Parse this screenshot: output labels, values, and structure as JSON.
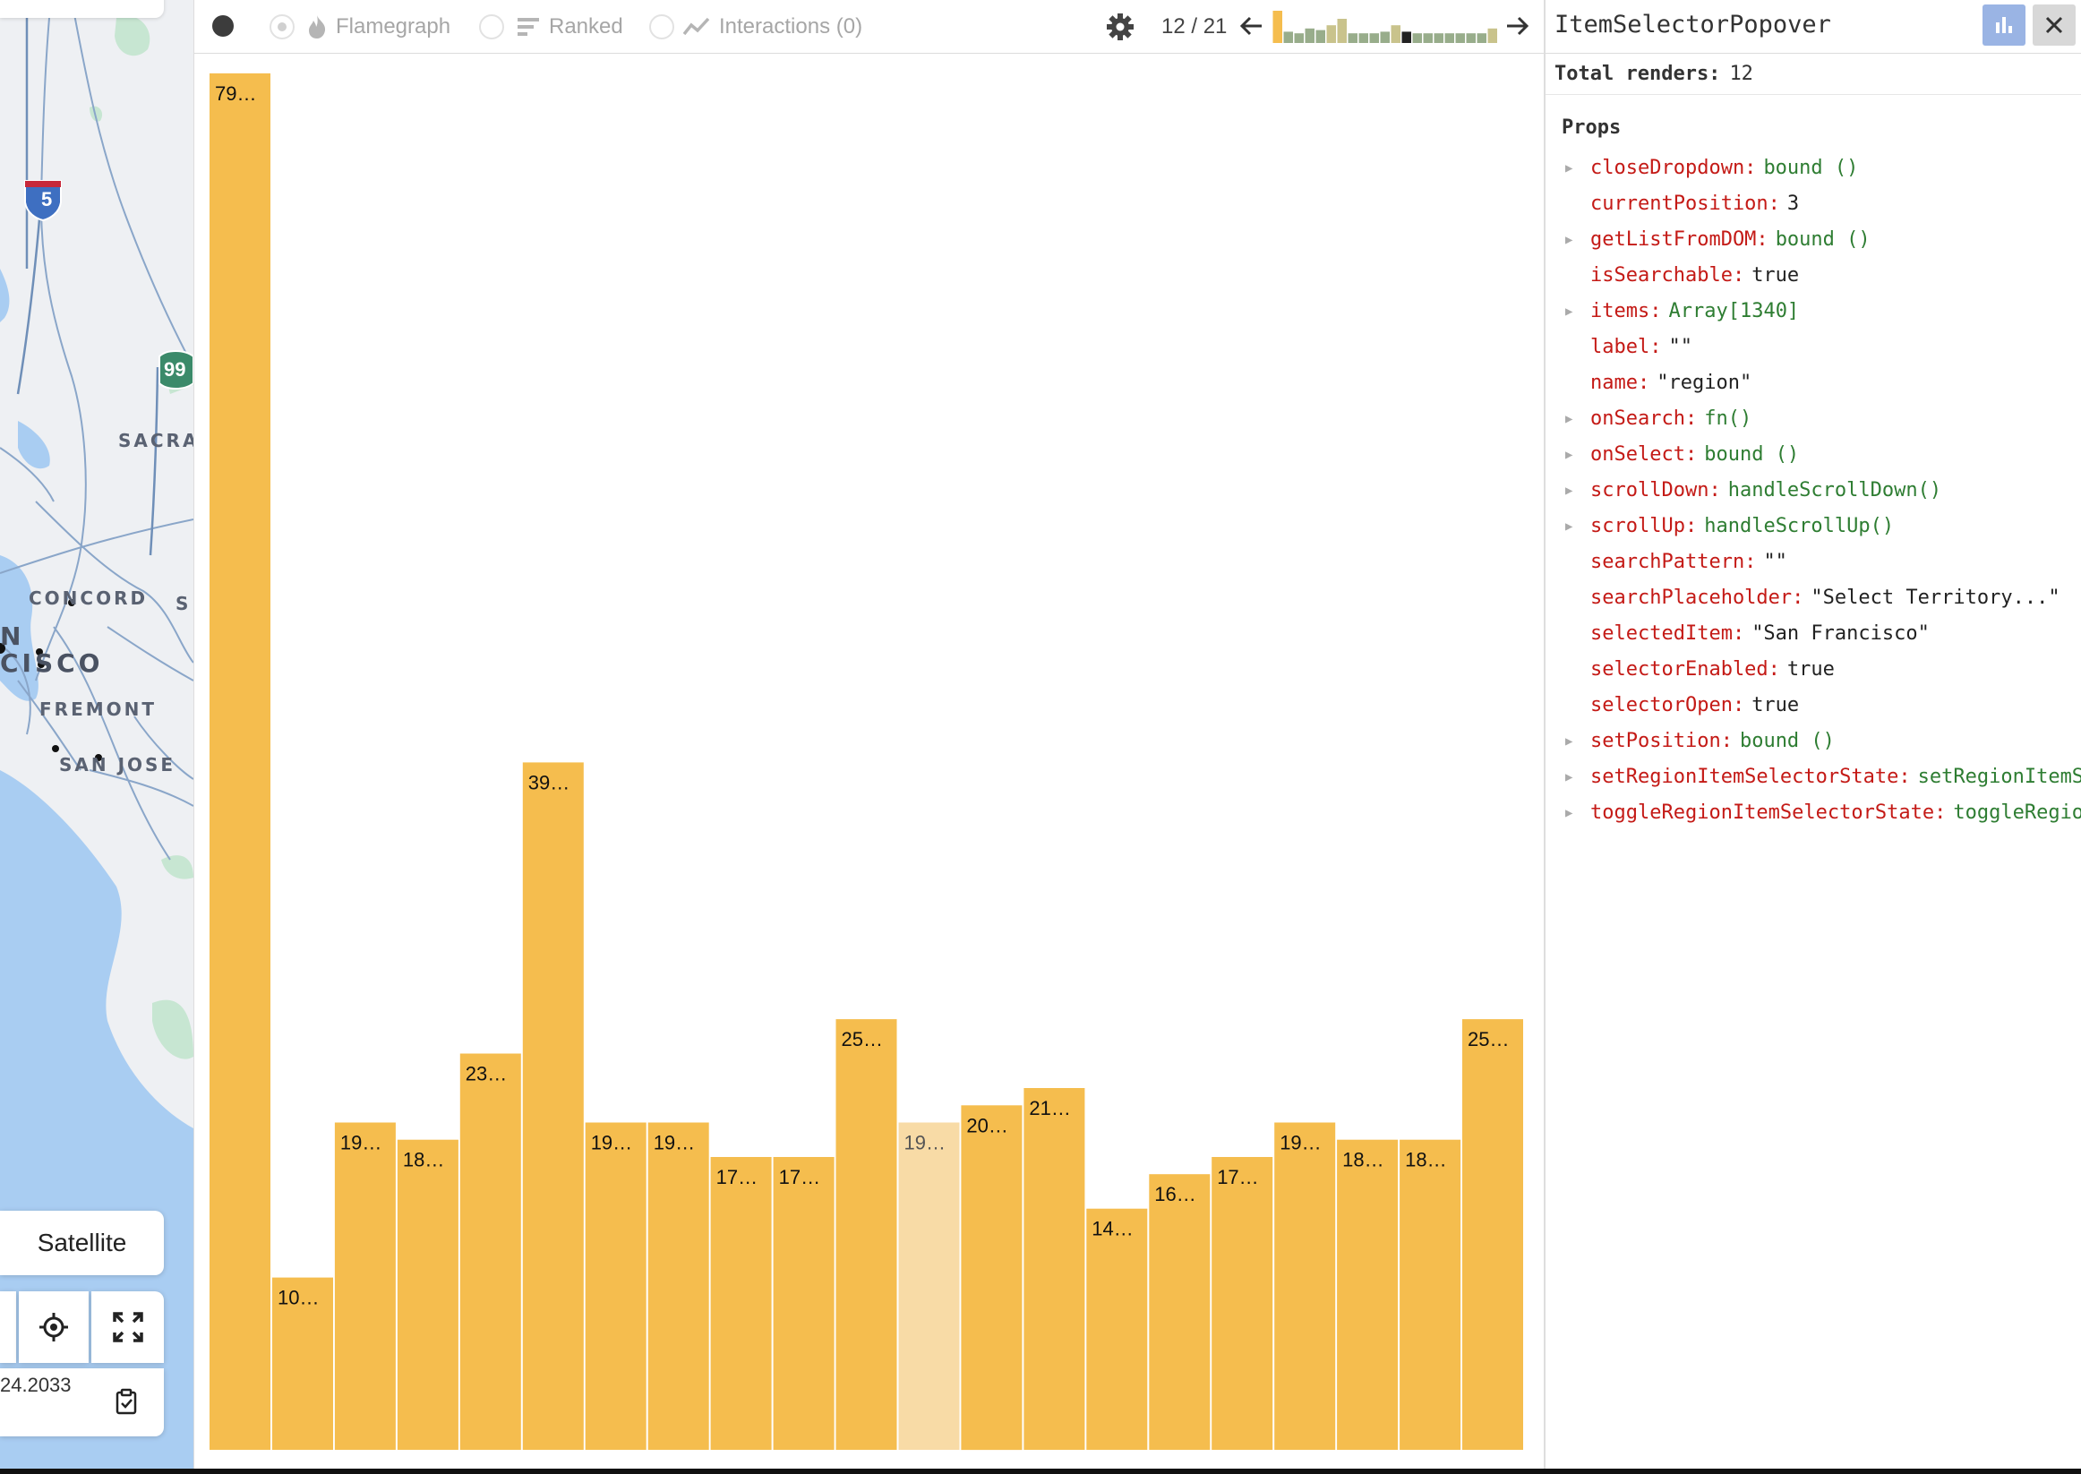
{
  "map": {
    "labels": [
      {
        "id": "sacramento",
        "text": "SACRAM"
      },
      {
        "id": "concord",
        "text": "CONCORD"
      },
      {
        "id": "sanfrancisco-1",
        "text": "N"
      },
      {
        "id": "sanfrancisco-2",
        "text": "CISCO"
      },
      {
        "id": "fremont",
        "text": "FREMONT"
      },
      {
        "id": "sanjose",
        "text": "SAN JOSE"
      },
      {
        "id": "st",
        "text": "S"
      }
    ],
    "shields": [
      {
        "id": "i5",
        "text": "5"
      },
      {
        "id": "ca99",
        "text": "99"
      }
    ],
    "satellite_label": "Satellite",
    "coordinate_text": "24.2033"
  },
  "toolbar": {
    "tabs": [
      {
        "id": "flamegraph",
        "label": "Flamegraph"
      },
      {
        "id": "ranked",
        "label": "Ranked"
      },
      {
        "id": "interactions",
        "label": "Interactions (0)"
      }
    ],
    "commit_counter": "12 / 21",
    "mini_commits": [
      {
        "h": 1.0,
        "color": "#f5bd4e"
      },
      {
        "h": 0.35,
        "color": "#98ad8b"
      },
      {
        "h": 0.3,
        "color": "#98ad8b"
      },
      {
        "h": 0.45,
        "color": "#98ad8b"
      },
      {
        "h": 0.4,
        "color": "#98ad8b"
      },
      {
        "h": 0.55,
        "color": "#c9c38c"
      },
      {
        "h": 0.75,
        "color": "#c9c38c"
      },
      {
        "h": 0.3,
        "color": "#98ad8b"
      },
      {
        "h": 0.3,
        "color": "#98ad8b"
      },
      {
        "h": 0.3,
        "color": "#98ad8b"
      },
      {
        "h": 0.35,
        "color": "#98ad8b"
      },
      {
        "h": 0.55,
        "color": "#c9c38c"
      },
      {
        "h": 0.35,
        "color": "#222222"
      },
      {
        "h": 0.3,
        "color": "#98ad8b"
      },
      {
        "h": 0.3,
        "color": "#98ad8b"
      },
      {
        "h": 0.3,
        "color": "#98ad8b"
      },
      {
        "h": 0.3,
        "color": "#98ad8b"
      },
      {
        "h": 0.3,
        "color": "#98ad8b"
      },
      {
        "h": 0.3,
        "color": "#98ad8b"
      },
      {
        "h": 0.3,
        "color": "#98ad8b"
      },
      {
        "h": 0.45,
        "color": "#c9c38c"
      }
    ]
  },
  "chart_data": {
    "type": "bar",
    "ylim": [
      0,
      80
    ],
    "bar_color": "#f5bd4e",
    "selected_color": "#f8dba6",
    "selected_index": 11,
    "values": [
      79.9,
      10,
      19,
      18,
      23,
      39.9,
      19,
      19,
      17,
      17,
      25,
      19,
      20,
      21,
      14,
      16,
      17,
      19,
      18,
      18,
      25
    ],
    "labels": [
      "79…",
      "10…",
      "19…",
      "18…",
      "23…",
      "39…",
      "19…",
      "19…",
      "17…",
      "17…",
      "25…",
      "19…",
      "20…",
      "21…",
      "14…",
      "16…",
      "17…",
      "19…",
      "18…",
      "18…",
      "25…"
    ]
  },
  "panel": {
    "title": "ItemSelectorPopover",
    "total_renders_label": "Total renders:",
    "total_renders_value": "12",
    "props_heading": "Props",
    "props": [
      {
        "key": "closeDropdown:",
        "value": "bound ()",
        "expandable": true,
        "kind": "fn"
      },
      {
        "key": "currentPosition:",
        "value": "3",
        "expandable": false,
        "kind": "plain"
      },
      {
        "key": "getListFromDOM:",
        "value": "bound ()",
        "expandable": true,
        "kind": "fn"
      },
      {
        "key": "isSearchable:",
        "value": "true",
        "expandable": false,
        "kind": "plain"
      },
      {
        "key": "items:",
        "value": "Array[1340]",
        "expandable": true,
        "kind": "fn"
      },
      {
        "key": "label:",
        "value": "\"\"",
        "expandable": false,
        "kind": "plain"
      },
      {
        "key": "name:",
        "value": "\"region\"",
        "expandable": false,
        "kind": "plain"
      },
      {
        "key": "onSearch:",
        "value": "fn()",
        "expandable": true,
        "kind": "fn"
      },
      {
        "key": "onSelect:",
        "value": "bound ()",
        "expandable": true,
        "kind": "fn"
      },
      {
        "key": "scrollDown:",
        "value": "handleScrollDown()",
        "expandable": true,
        "kind": "fn"
      },
      {
        "key": "scrollUp:",
        "value": "handleScrollUp()",
        "expandable": true,
        "kind": "fn"
      },
      {
        "key": "searchPattern:",
        "value": "\"\"",
        "expandable": false,
        "kind": "plain"
      },
      {
        "key": "searchPlaceholder:",
        "value": "\"Select Territory...\"",
        "expandable": false,
        "kind": "plain"
      },
      {
        "key": "selectedItem:",
        "value": "\"San Francisco\"",
        "expandable": false,
        "kind": "plain"
      },
      {
        "key": "selectorEnabled:",
        "value": "true",
        "expandable": false,
        "kind": "plain"
      },
      {
        "key": "selectorOpen:",
        "value": "true",
        "expandable": false,
        "kind": "plain"
      },
      {
        "key": "setPosition:",
        "value": "bound ()",
        "expandable": true,
        "kind": "fn"
      },
      {
        "key": "setRegionItemSelectorState:",
        "value": "setRegionItemS",
        "expandable": true,
        "kind": "fn"
      },
      {
        "key": "toggleRegionItemSelectorState:",
        "value": "toggleRegio",
        "expandable": true,
        "kind": "fn"
      }
    ]
  }
}
